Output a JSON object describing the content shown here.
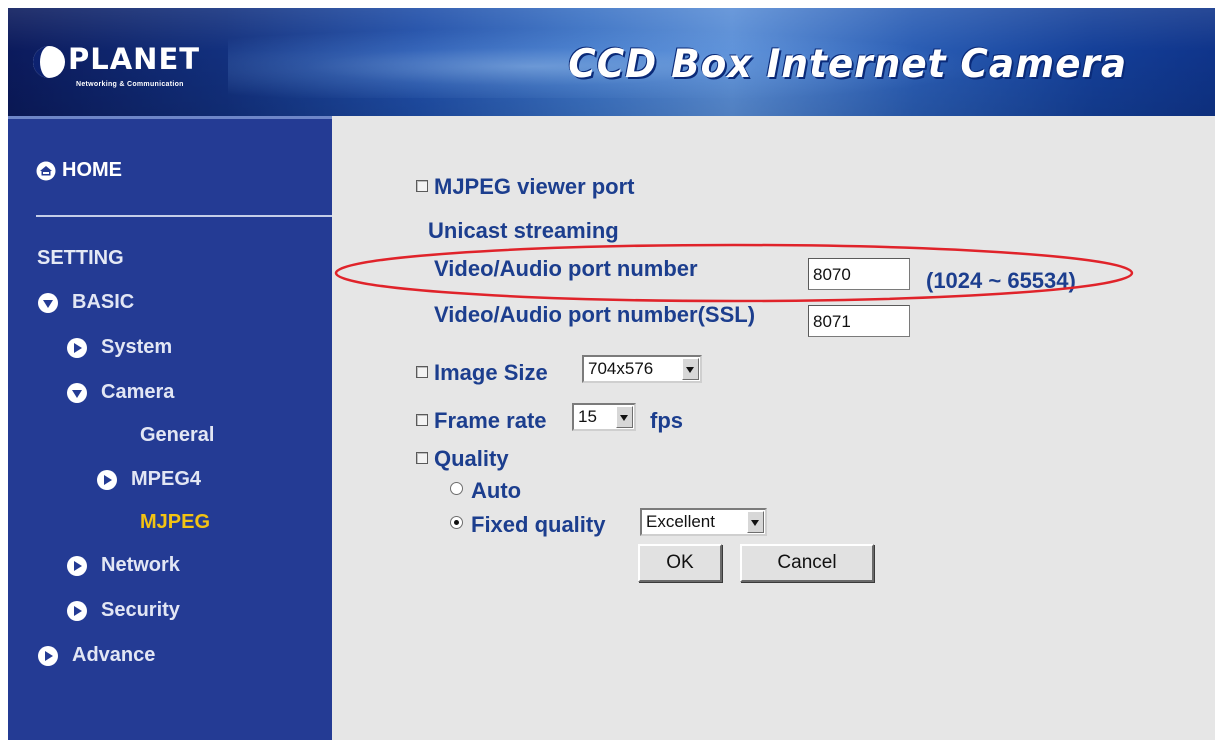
{
  "header": {
    "brand": "PLANET",
    "brand_tagline": "Networking & Communication",
    "product_title": "CCD Box Internet Camera"
  },
  "sidebar": {
    "home": "HOME",
    "section_title": "SETTING",
    "items": {
      "basic": "BASIC",
      "system": "System",
      "camera": "Camera",
      "general": "General",
      "mpeg4": "MPEG4",
      "mjpeg": "MJPEG",
      "network": "Network",
      "security": "Security",
      "advance": "Advance"
    },
    "active_item": "MJPEG",
    "active_color": "#f3c312"
  },
  "form": {
    "viewer_port_title": "MJPEG viewer port",
    "unicast_title": "Unicast streaming",
    "port_label": "Video/Audio port number",
    "port_value": "8070",
    "port_range": "(1024 ~ 65534)",
    "ssl_port_label": "Video/Audio port number(SSL)",
    "ssl_port_value": "8071",
    "image_size_label": "Image Size",
    "image_size_value": "704x576",
    "frame_rate_label": "Frame rate",
    "frame_rate_value": "15",
    "frame_rate_unit": "fps",
    "quality_label": "Quality",
    "quality_auto": "Auto",
    "quality_fixed": "Fixed quality",
    "quality_fixed_value": "Excellent",
    "quality_selected": "fixed",
    "ok_label": "OK",
    "cancel_label": "Cancel"
  },
  "colors": {
    "sidebar_bg": "#243b94",
    "label_blue": "#1c3e8e",
    "highlight_ellipse": "#e0232a"
  }
}
